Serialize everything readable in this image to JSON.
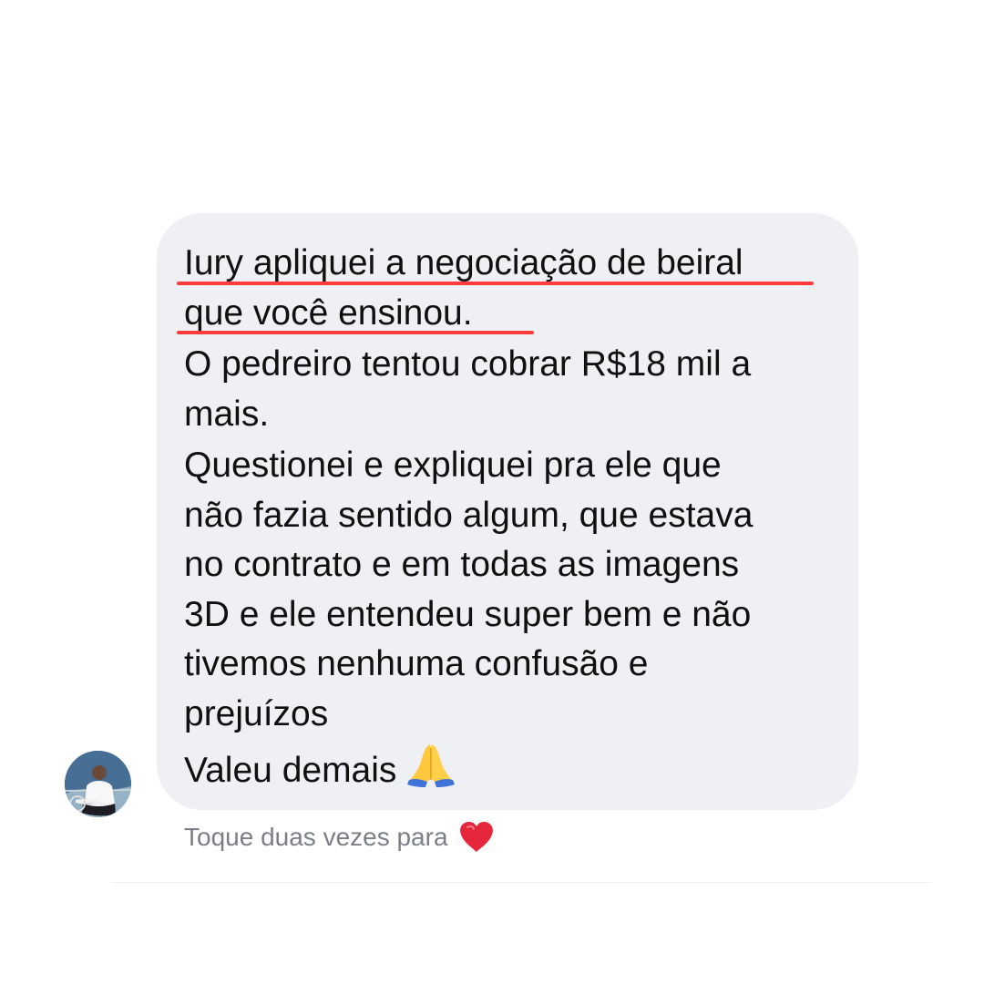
{
  "message": {
    "lines": [
      "Iury apliquei a negociação de beiral",
      "que você ensinou.",
      "O pedreiro tentou cobrar R$18 mil a",
      "mais.",
      "Questionei e expliquei pra ele que",
      "não fazia sentido algum, que estava",
      "no contrato e em todas as imagens",
      "3D e ele entendeu super bem e não",
      "tivemos nenhuma confusão e",
      "prejuízos",
      "Valeu demais"
    ],
    "emoji_icon": "praying-hands-icon"
  },
  "reaction_hint": {
    "text": "Toque duas vezes para",
    "icon": "heart-icon"
  },
  "colors": {
    "bubble_background": "#eff0f4",
    "message_text": "#101010",
    "highlight_underline": "#ff3c3c",
    "hint_text": "#7b7f86",
    "heart": "#e6263a"
  }
}
